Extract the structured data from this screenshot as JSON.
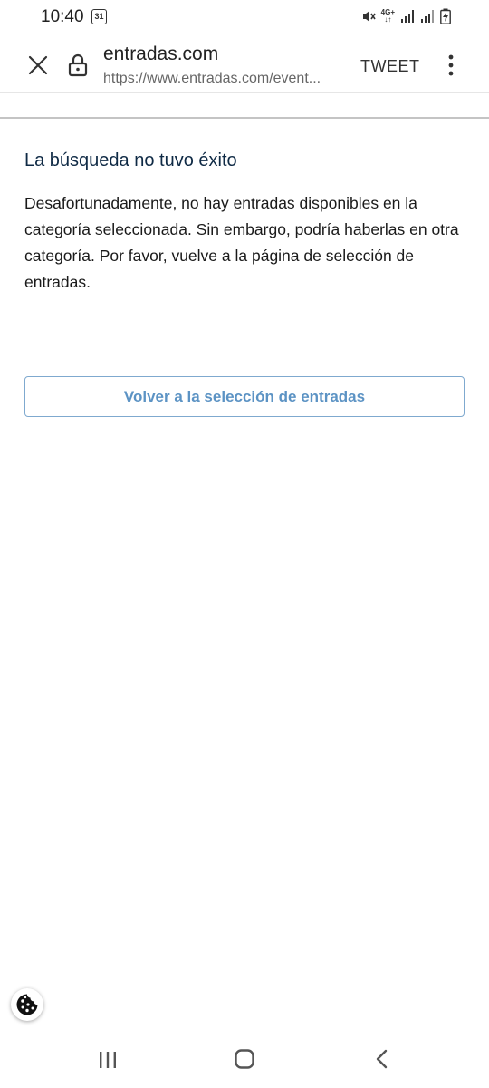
{
  "status_bar": {
    "time": "10:40",
    "calendar_day": "31",
    "network_label": "4G+"
  },
  "toolbar": {
    "site_title": "entradas.com",
    "site_url": "https://www.entradas.com/event...",
    "tweet_label": "TWEET"
  },
  "main": {
    "heading": "La búsqueda no tuvo éxito",
    "message": "Desafortunadamente, no hay entradas disponibles en la categoría seleccionada. Sin embargo, podría haberlas en otra categoría. Por favor, vuelve a la página de selección de entradas.",
    "back_button_label": "Volver a la selección de entradas"
  },
  "colors": {
    "heading": "#0f2a45",
    "button_text": "#5c93c4",
    "button_border": "#7fa9cf"
  },
  "icons": {
    "close": "close-icon",
    "lock": "lock-icon",
    "menu": "more-vert-icon",
    "cookie": "cookie-icon"
  }
}
